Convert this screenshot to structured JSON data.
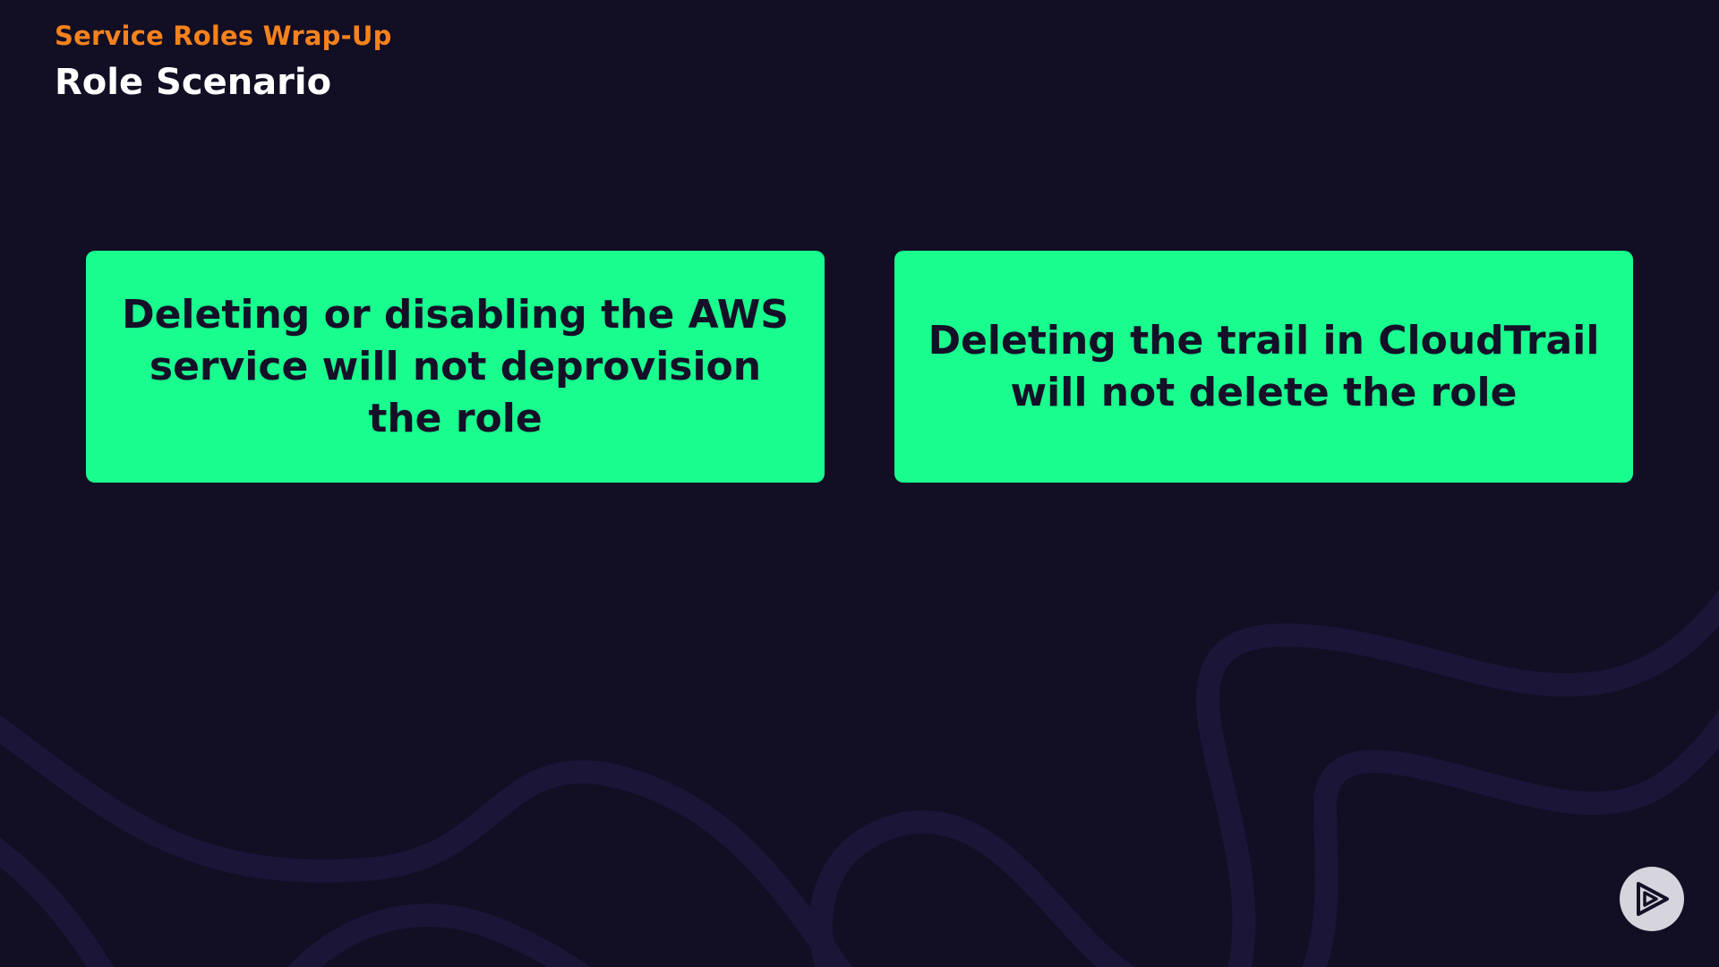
{
  "header": {
    "subtitle": "Service Roles Wrap-Up",
    "title": "Role Scenario"
  },
  "cards": [
    {
      "text": "Deleting or disabling the AWS service will not deprovision the role"
    },
    {
      "text": "Deleting the trail in CloudTrail will not delete the role"
    }
  ],
  "colors": {
    "background": "#120e24",
    "subtitle": "#f6821e",
    "title": "#ffffff",
    "card_background": "#18fd8e",
    "card_text": "#141027",
    "wave": "#1b1538",
    "nav_button": "#d6d4dc"
  },
  "icons": {
    "nav_button": "play-logo-icon"
  }
}
